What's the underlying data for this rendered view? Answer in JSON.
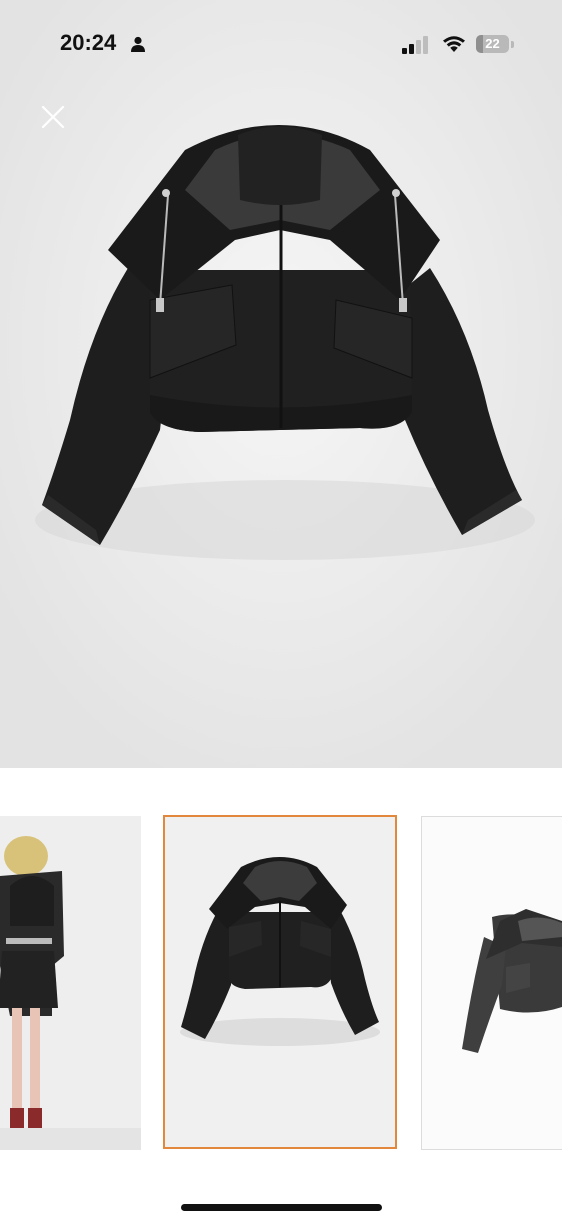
{
  "status_bar": {
    "time": "20:24",
    "person_icon": "person-icon",
    "signal_icon": "cellular-signal-icon",
    "wifi_icon": "wifi-icon",
    "battery_level": "22",
    "battery_fraction": 0.22
  },
  "viewer": {
    "close_icon": "close-icon",
    "main_image": "cropped-black-hooded-jacket",
    "thumbnails": [
      {
        "name": "model-wearing-jacket",
        "selected": false
      },
      {
        "name": "jacket-front-flat",
        "selected": true
      },
      {
        "name": "jacket-side-view",
        "selected": false
      }
    ],
    "selected_border_color": "#e2883c"
  },
  "colors": {
    "background": "#ffffff",
    "jacket": "#1c1c1c"
  }
}
